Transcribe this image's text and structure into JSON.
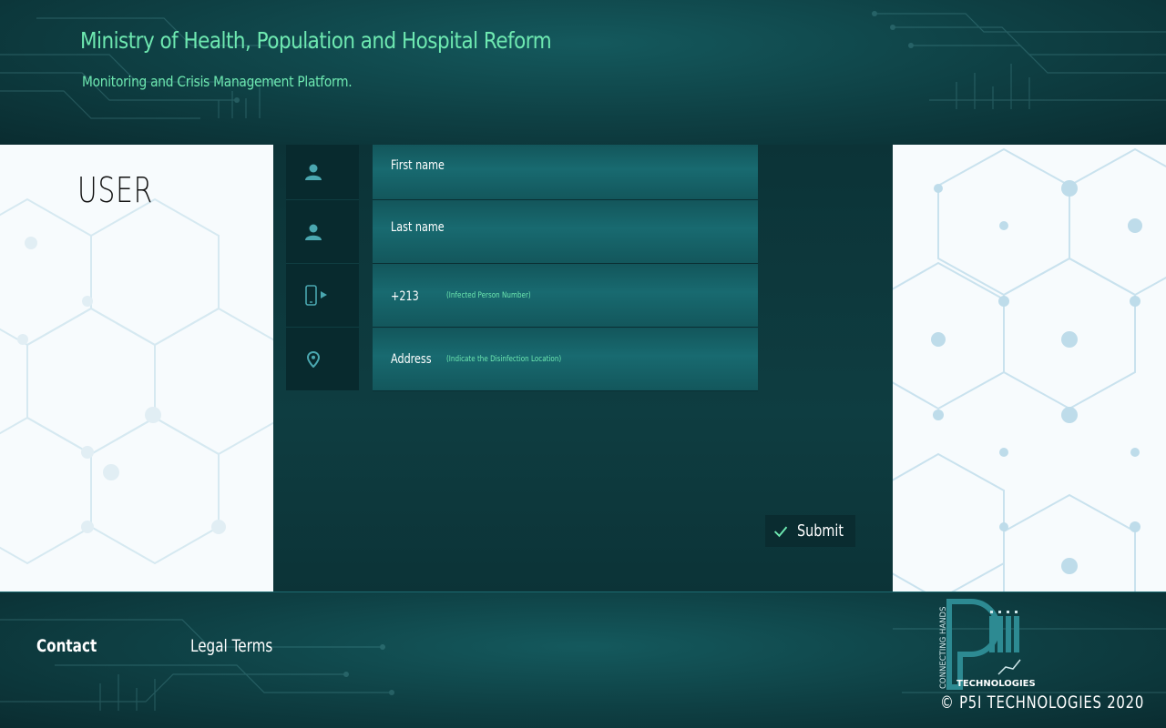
{
  "header": {
    "title": "Ministry of Health, Population and Hospital Reform",
    "subtitle": "Monitoring and Crisis Management Platform."
  },
  "sidebar": {
    "heading": "USER"
  },
  "form": {
    "fields": [
      {
        "icon": "user-icon",
        "label": "First name",
        "hint": ""
      },
      {
        "icon": "user-icon",
        "label": "Last name",
        "hint": ""
      },
      {
        "icon": "phone-icon",
        "label": "+213",
        "hint": "(Infected Person Number)"
      },
      {
        "icon": "location-pin-icon",
        "label": "Address",
        "hint": "(Indicate the Disinfection Location)"
      }
    ],
    "submit_label": "Submit"
  },
  "footer": {
    "contact_label": "Contact",
    "legal_label": "Legal Terms",
    "logo_tagline": "CONNECTING HANDS",
    "logo_word": "TECHNOLOGIES",
    "copyright": "© P5I TECHNOLOGIES 2020"
  },
  "colors": {
    "accent": "#6ee9b1",
    "icon": "#4aa7b0",
    "header_bg": "#0e3f43",
    "field_bg": "#186a70",
    "icon_column_bg": "#082a2e"
  }
}
